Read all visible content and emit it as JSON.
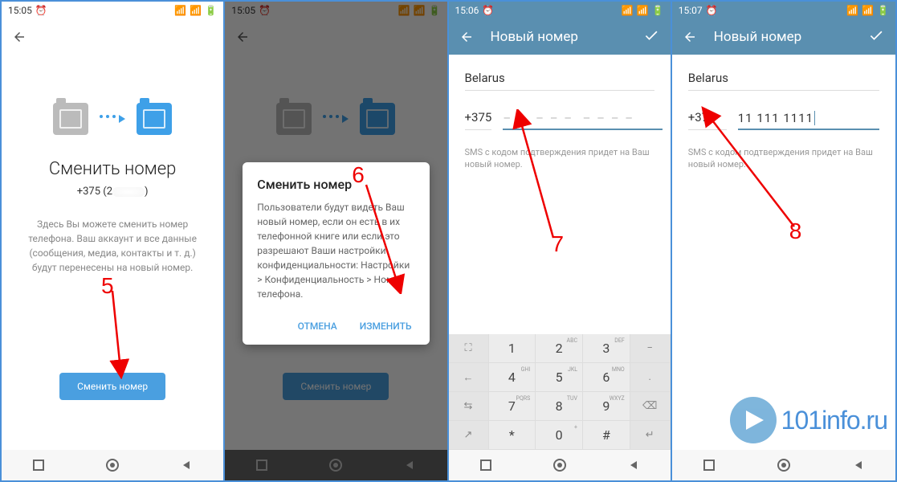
{
  "screens": [
    {
      "time": "15:05",
      "title": "Сменить номер",
      "phone_prefix": "+375 (2",
      "description": "Здесь Вы можете сменить номер телефона. Ваш аккаунт и все данные (сообщения, медиа, контакты и т. д.) будут перенесены на новый номер.",
      "button": "Сменить номер",
      "annotation": "5"
    },
    {
      "time": "15:05",
      "title": "Сменить номер",
      "dialog_title": "Сменить номер",
      "dialog_body": "Пользователи будут видеть Ваш новый номер, если он есть в их телефонной книге или если это разрешают Ваши настройки конфиденциальности: Настройки > Конфиденциальность > Номер телефона.",
      "cancel": "ОТМЕНА",
      "confirm": "ИЗМЕНИТЬ",
      "button": "Сменить номер",
      "annotation": "6"
    },
    {
      "time": "15:06",
      "appbar_title": "Новый номер",
      "country": "Belarus",
      "code": "+375",
      "placeholder": "– –  – – –  – – – –",
      "phone_value": "",
      "hint": "SMS с кодом подтверждения придет на Ваш новый номер.",
      "annotation": "7"
    },
    {
      "time": "15:07",
      "appbar_title": "Новый номер",
      "country": "Belarus",
      "code": "+375",
      "phone_value": "11 111 1111",
      "hint": "SMS с кодом подтверждения придет на Ваш новый номер.",
      "annotation": "8"
    }
  ],
  "keypad": {
    "keys": [
      {
        "n": "1",
        "s": ""
      },
      {
        "n": "2",
        "s": "ABC"
      },
      {
        "n": "3",
        "s": "DEF"
      },
      {
        "n": "4",
        "s": "GHI"
      },
      {
        "n": "5",
        "s": "JKL"
      },
      {
        "n": "6",
        "s": "MNO"
      },
      {
        "n": "7",
        "s": "PQRS"
      },
      {
        "n": "8",
        "s": "TUV"
      },
      {
        "n": "9",
        "s": "WXYZ"
      },
      {
        "n": "*",
        "s": ""
      },
      {
        "n": "0",
        "s": "+"
      },
      {
        "n": "#",
        "s": ""
      }
    ],
    "side_left": [
      "⛶",
      "←",
      "⇆",
      "↗"
    ],
    "side_right": [
      "−",
      ".",
      "⌫",
      "↵"
    ]
  },
  "watermark": "101info.ru"
}
